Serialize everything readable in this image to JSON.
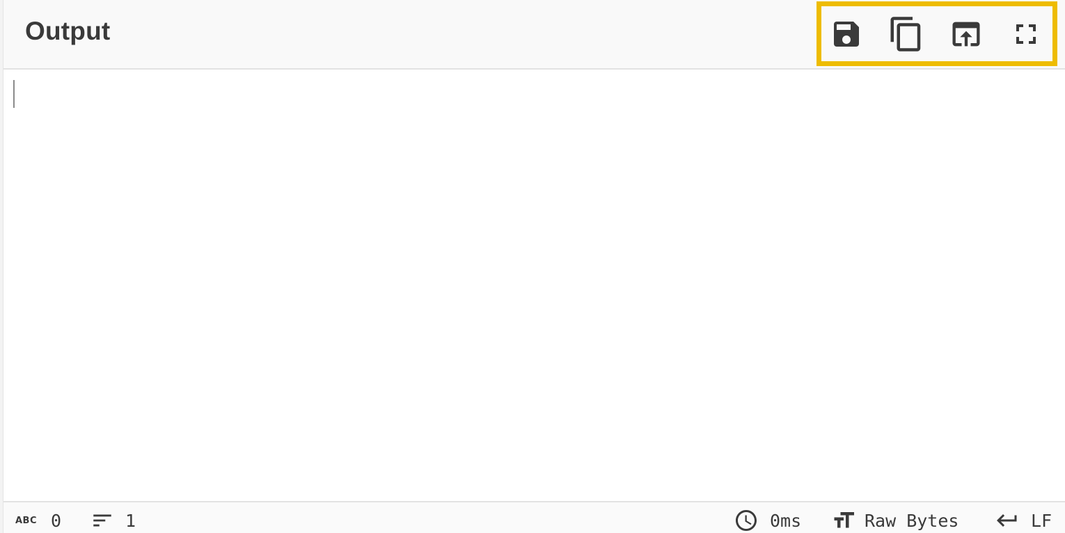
{
  "panel": {
    "title": "Output"
  },
  "toolbar": {
    "buttons": [
      {
        "name": "save-button",
        "icon": "save-icon",
        "label": "Save output to file"
      },
      {
        "name": "copy-button",
        "icon": "copy-icon",
        "label": "Copy raw output to the clipboard"
      },
      {
        "name": "replace-input-button",
        "icon": "open-in-input-icon",
        "label": "Replace input with output"
      },
      {
        "name": "maximise-button",
        "icon": "fullscreen-icon",
        "label": "Maximise output pane"
      }
    ],
    "highlight_color": "#eebc00"
  },
  "editor": {
    "content": ""
  },
  "status": {
    "length_icon": "ABC",
    "length": "0",
    "lines_icon": "lines-icon",
    "lines": "1",
    "time_icon": "clock-icon",
    "time": "0ms",
    "encoding_icon": "text-size-icon",
    "encoding": "Raw Bytes",
    "eol_icon": "return-icon",
    "eol": "LF"
  },
  "colors": {
    "icon": "#3a3a3a",
    "header_bg": "#f9f9f9",
    "border": "#e2e2e2"
  }
}
